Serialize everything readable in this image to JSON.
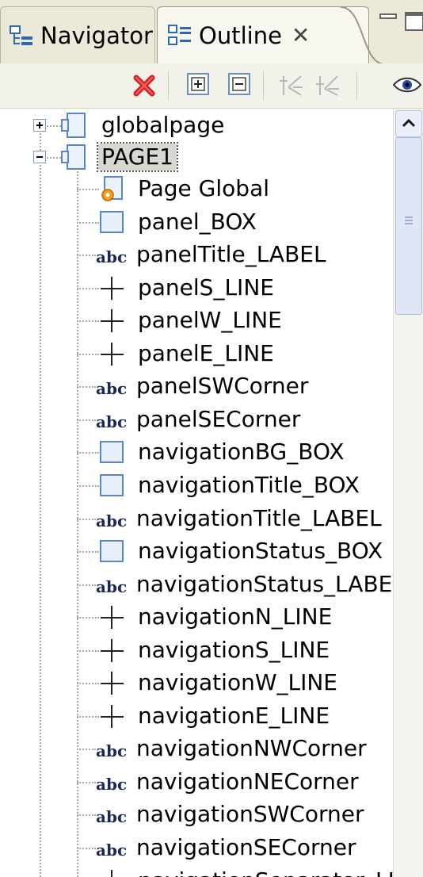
{
  "tabs": {
    "navigator": {
      "label": "Navigator"
    },
    "outline": {
      "label": "Outline",
      "close": "✕"
    }
  },
  "toolbar": {
    "icons": [
      "delete-icon",
      "expand-all-icon",
      "collapse-all-icon",
      "move-up-icon",
      "move-down-icon",
      "view-icon"
    ]
  },
  "tree": {
    "roots": [
      {
        "label": "globalpage",
        "expanded": false
      },
      {
        "label": "PAGE1",
        "expanded": true,
        "selected": true
      }
    ],
    "children": [
      {
        "label": "Page Global",
        "icon": "page-settings-icon"
      },
      {
        "label": "panel_BOX",
        "icon": "box-icon"
      },
      {
        "label": "panelTitle_LABEL",
        "icon": "label-icon"
      },
      {
        "label": "panelS_LINE",
        "icon": "line-icon"
      },
      {
        "label": "panelW_LINE",
        "icon": "line-icon"
      },
      {
        "label": "panelE_LINE",
        "icon": "line-icon"
      },
      {
        "label": "panelSWCorner",
        "icon": "label-icon"
      },
      {
        "label": "panelSECorner",
        "icon": "label-icon"
      },
      {
        "label": "navigationBG_BOX",
        "icon": "box-icon"
      },
      {
        "label": "navigationTitle_BOX",
        "icon": "box-icon"
      },
      {
        "label": "navigationTitle_LABEL",
        "icon": "label-icon"
      },
      {
        "label": "navigationStatus_BOX",
        "icon": "box-icon"
      },
      {
        "label": "navigationStatus_LABEL",
        "icon": "label-icon"
      },
      {
        "label": "navigationN_LINE",
        "icon": "line-icon"
      },
      {
        "label": "navigationS_LINE",
        "icon": "line-icon"
      },
      {
        "label": "navigationW_LINE",
        "icon": "line-icon"
      },
      {
        "label": "navigationE_LINE",
        "icon": "line-icon"
      },
      {
        "label": "navigationNWCorner",
        "icon": "label-icon"
      },
      {
        "label": "navigationNECorner",
        "icon": "label-icon"
      },
      {
        "label": "navigationSWCorner",
        "icon": "label-icon"
      },
      {
        "label": "navigationSECorner",
        "icon": "label-icon"
      },
      {
        "label": "navigationSeparator_LINE",
        "icon": "line-icon"
      }
    ]
  },
  "colors": {
    "tabbar": "#ece9d8",
    "box_fill": "#e8f0fb",
    "box_stroke": "#5b85c4",
    "delete_red": "#d42020",
    "label_icon": "#1a2a55"
  }
}
